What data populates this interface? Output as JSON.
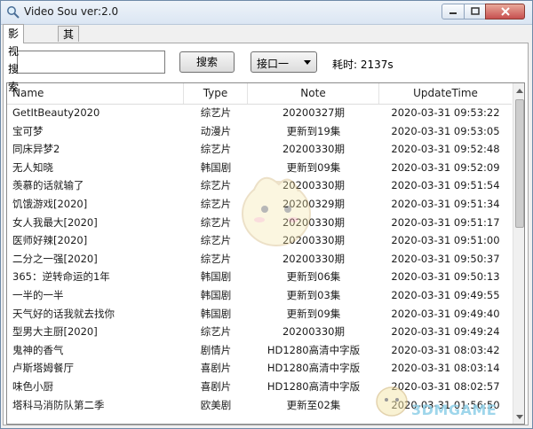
{
  "window": {
    "title": "Video Sou ver:2.0"
  },
  "tabs": [
    {
      "label": "影视搜索",
      "active": true
    },
    {
      "label": "其他设置",
      "active": false
    }
  ],
  "search": {
    "value": "",
    "button_label": "搜索"
  },
  "source_select": {
    "selected": "接口一"
  },
  "timing": {
    "label": "耗时: 2137s"
  },
  "table": {
    "columns": [
      "Name",
      "Type",
      "Note",
      "UpdateTime"
    ],
    "rows": [
      [
        "GetItBeauty2020",
        "综艺片",
        "20200327期",
        "2020-03-31 09:53:22"
      ],
      [
        "宝可梦",
        "动漫片",
        "更新到19集",
        "2020-03-31 09:53:05"
      ],
      [
        "同床异梦2",
        "综艺片",
        "20200330期",
        "2020-03-31 09:52:48"
      ],
      [
        "无人知晓",
        "韩国剧",
        "更新到09集",
        "2020-03-31 09:52:09"
      ],
      [
        "羡慕的话就输了",
        "综艺片",
        "20200330期",
        "2020-03-31 09:51:54"
      ],
      [
        "饥饿游戏[2020]",
        "综艺片",
        "20200329期",
        "2020-03-31 09:51:34"
      ],
      [
        "女人我最大[2020]",
        "综艺片",
        "20200330期",
        "2020-03-31 09:51:17"
      ],
      [
        "医师好辣[2020]",
        "综艺片",
        "20200330期",
        "2020-03-31 09:51:00"
      ],
      [
        "二分之一强[2020]",
        "综艺片",
        "20200330期",
        "2020-03-31 09:50:37"
      ],
      [
        "365：逆转命运的1年",
        "韩国剧",
        "更新到06集",
        "2020-03-31 09:50:13"
      ],
      [
        "一半的一半",
        "韩国剧",
        "更新到03集",
        "2020-03-31 09:49:55"
      ],
      [
        "天气好的话我就去找你",
        "韩国剧",
        "更新到09集",
        "2020-03-31 09:49:40"
      ],
      [
        "型男大主厨[2020]",
        "综艺片",
        "20200330期",
        "2020-03-31 09:49:24"
      ],
      [
        "鬼神的香气",
        "剧情片",
        "HD1280高清中字版",
        "2020-03-31 08:03:42"
      ],
      [
        "卢斯塔姆餐厅",
        "喜剧片",
        "HD1280高清中字版",
        "2020-03-31 08:03:14"
      ],
      [
        "味色小厨",
        "喜剧片",
        "HD1280高清中字版",
        "2020-03-31 08:02:57"
      ],
      [
        "塔科马消防队第二季",
        "欧美剧",
        "更新至02集",
        "2020-03-31 01:56:50"
      ]
    ]
  },
  "watermark": {
    "text": "3DMGAME"
  },
  "colors": {
    "titlebar": "#dbe6f3",
    "close": "#c75050",
    "border": "#8a8a8a"
  }
}
